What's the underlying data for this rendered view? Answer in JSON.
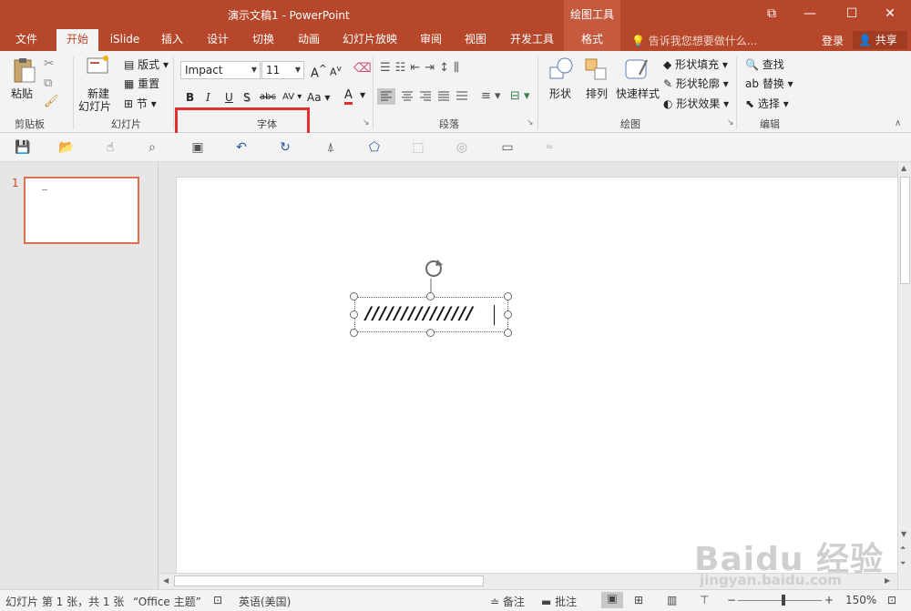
{
  "window": {
    "title": "演示文稿1 - PowerPoint",
    "context_tab_group": "绘图工具",
    "controls": {
      "restore": "⧉",
      "minimize": "—",
      "maximize": "☐",
      "close": "✕"
    }
  },
  "tabs": [
    "文件",
    "开始",
    "iSlide",
    "插入",
    "设计",
    "切换",
    "动画",
    "幻灯片放映",
    "审阅",
    "视图",
    "开发工具",
    "格式"
  ],
  "active_tab": "开始",
  "tell_me": "告诉我您想要做什么...",
  "login": "登录",
  "share": "共享",
  "ribbon": {
    "clipboard": {
      "paste": "粘贴",
      "group": "剪贴板"
    },
    "slides": {
      "new_slide_line1": "新建",
      "new_slide_line2": "幻灯片",
      "layout": "版式",
      "reset": "重置",
      "section": "节",
      "group": "幻灯片"
    },
    "font": {
      "font_name": "Impact",
      "font_size": "11",
      "bold": "B",
      "italic": "I",
      "underline": "U",
      "shadow": "S",
      "strike": "abc",
      "spacing": "AV",
      "case": "Aa",
      "font_color": "A",
      "grow": "A",
      "shrink": "A",
      "group": "字体"
    },
    "paragraph": {
      "group": "段落"
    },
    "drawing": {
      "shapes": "形状",
      "arrange": "排列",
      "quick_styles": "快速样式",
      "fill": "形状填充",
      "outline": "形状轮廓",
      "effects": "形状效果",
      "group": "绘图"
    },
    "editing": {
      "find": "查找",
      "replace": "替换",
      "select": "选择",
      "group": "编辑"
    }
  },
  "slide_panel": {
    "slide_number": "1"
  },
  "textbox": {
    "text": "///////////////"
  },
  "status": {
    "slide_info": "幻灯片 第 1 张，共 1 张",
    "theme": "“Office 主题”",
    "language": "英语(美国)",
    "notes": "备注",
    "comments": "批注",
    "zoom": "150%",
    "zoom_minus": "−",
    "zoom_plus": "+"
  },
  "watermark": {
    "brand": "Baidu 经验",
    "url": "jingyan.baidu.com"
  },
  "colors": {
    "accent": "#b7472a",
    "highlight": "#e0312f"
  }
}
